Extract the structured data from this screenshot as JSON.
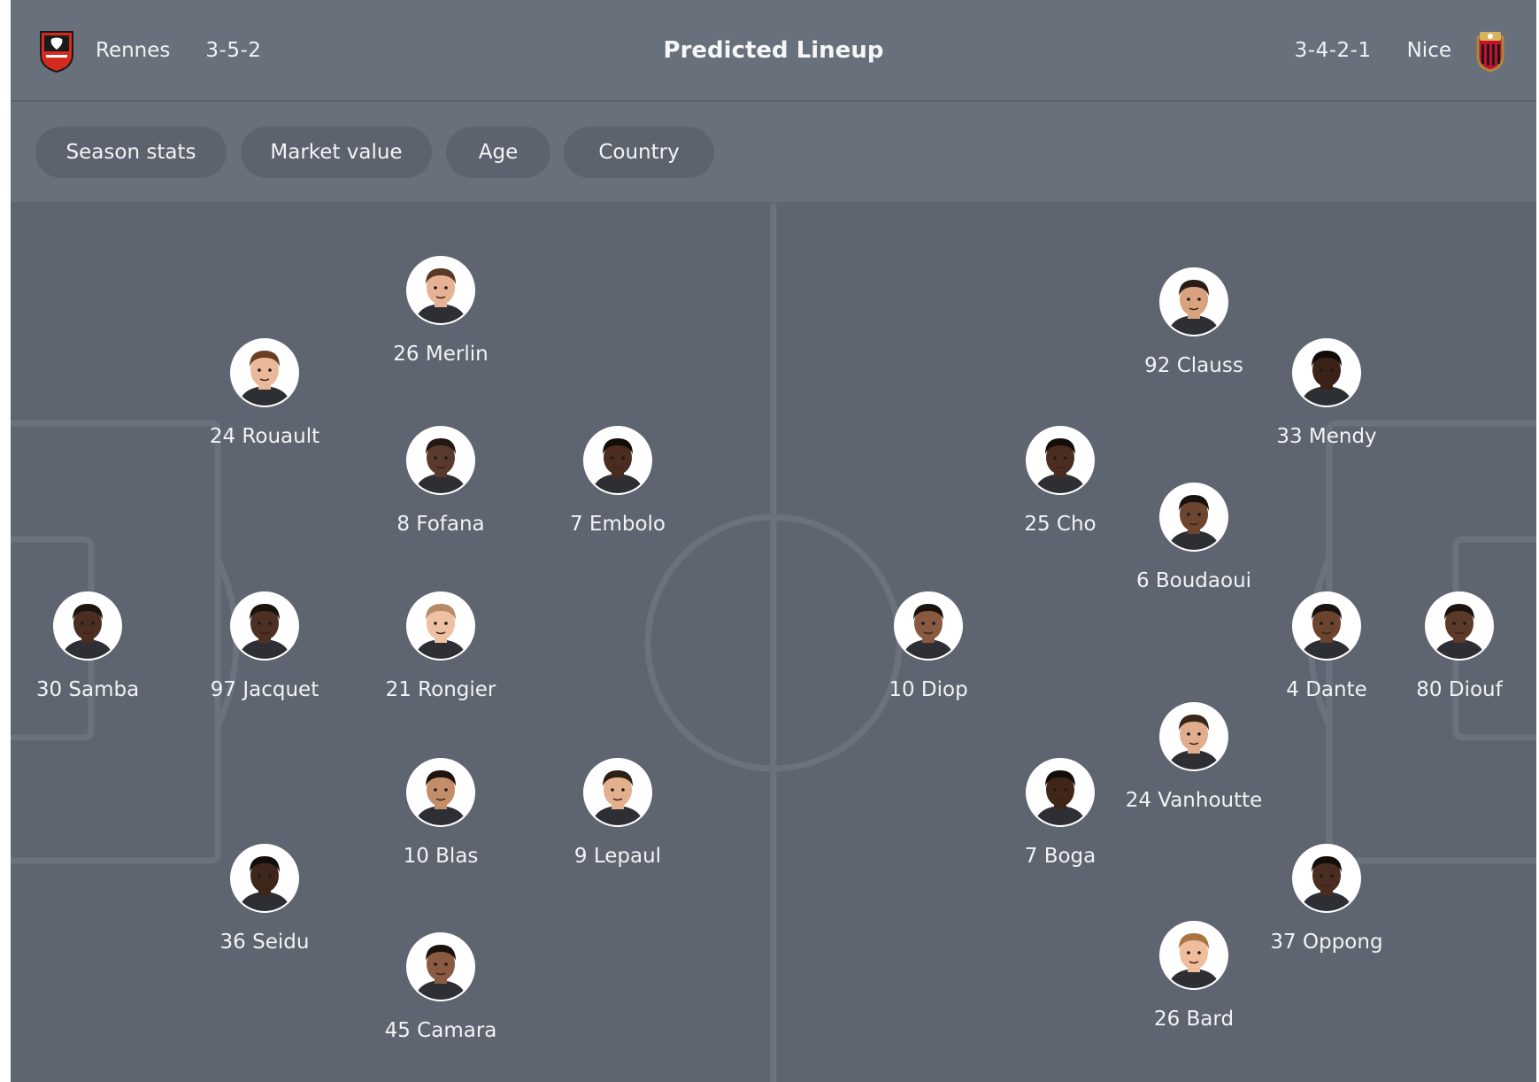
{
  "header": {
    "title": "Predicted Lineup",
    "home": {
      "name": "Rennes",
      "formation": "3-5-2",
      "crest_icon": "rennes-crest-icon",
      "crest_color": "#d52b1e"
    },
    "away": {
      "name": "Nice",
      "formation": "3-4-2-1",
      "crest_icon": "nice-crest-icon",
      "crest_color": "#c8102e"
    }
  },
  "filters": [
    "Season stats",
    "Market value",
    "Age",
    "Country"
  ],
  "colors": {
    "header_bg": "#68707b",
    "pitch_bg": "#5e6470",
    "chip_bg": "#5c636e",
    "line": "#6d7480"
  },
  "players": {
    "home": [
      {
        "label": "30 Samba",
        "skin": "#4a2e22",
        "hair": "#1c1410"
      },
      {
        "label": "24 Rouault",
        "skin": "#e9b99a",
        "hair": "#6b3d22"
      },
      {
        "label": "97 Jacquet",
        "skin": "#4d3024",
        "hair": "#1a120e"
      },
      {
        "label": "36 Seidu",
        "skin": "#3f261b",
        "hair": "#140e0b"
      },
      {
        "label": "26 Merlin",
        "skin": "#e6b294",
        "hair": "#5a3a26"
      },
      {
        "label": "8 Fofana",
        "skin": "#5a3a2c",
        "hair": "#231813"
      },
      {
        "label": "21 Rongier",
        "skin": "#eec1a5",
        "hair": "#b58a64"
      },
      {
        "label": "10 Blas",
        "skin": "#c48d6a",
        "hair": "#1e1510"
      },
      {
        "label": "45 Camara",
        "skin": "#8a5a42",
        "hair": "#1a120e"
      },
      {
        "label": "7 Embolo",
        "skin": "#4a2d20",
        "hair": "#140e0b"
      },
      {
        "label": "9 Lepaul",
        "skin": "#e3b08e",
        "hair": "#2e1f16"
      }
    ],
    "away": [
      {
        "label": "80 Diouf",
        "skin": "#5b3a2a",
        "hair": "#1a120e"
      },
      {
        "label": "33 Mendy",
        "skin": "#3a2219",
        "hair": "#120c09"
      },
      {
        "label": "4 Dante",
        "skin": "#6b432f",
        "hair": "#1a120e"
      },
      {
        "label": "37 Oppong",
        "skin": "#4a2d20",
        "hair": "#140e0b"
      },
      {
        "label": "92 Clauss",
        "skin": "#d9a27f",
        "hair": "#2a1c14"
      },
      {
        "label": "6 Boudaoui",
        "skin": "#6e4530",
        "hair": "#1a120e"
      },
      {
        "label": "24 Vanhoutte",
        "skin": "#e0ae8e",
        "hair": "#3a271b"
      },
      {
        "label": "26 Bard",
        "skin": "#efbd9c",
        "hair": "#a9743f"
      },
      {
        "label": "25 Cho",
        "skin": "#4a2d20",
        "hair": "#140e0b"
      },
      {
        "label": "7 Boga",
        "skin": "#402619",
        "hair": "#140e0b"
      },
      {
        "label": "10 Diop",
        "skin": "#8a5a40",
        "hair": "#1a120e"
      }
    ]
  }
}
